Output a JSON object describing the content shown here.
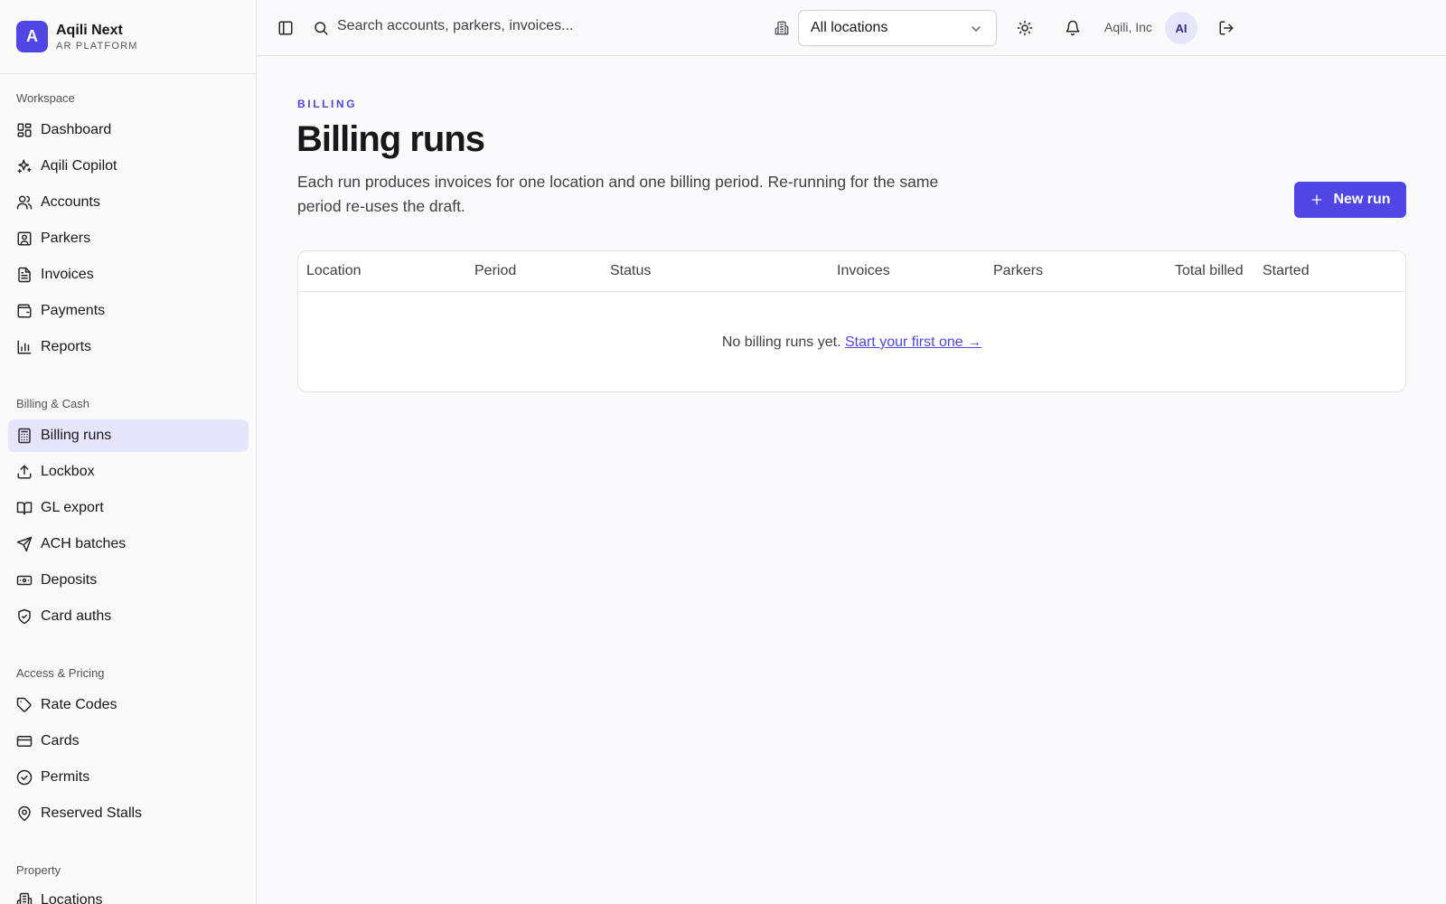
{
  "brand": {
    "logo_letter": "A",
    "name": "Aqili Next",
    "subtitle": "AR PLATFORM"
  },
  "sidebar": {
    "sections": [
      {
        "title": "Workspace",
        "items": [
          {
            "label": "Dashboard",
            "icon": "dashboard-icon"
          },
          {
            "label": "Aqili Copilot",
            "icon": "sparkles-icon"
          },
          {
            "label": "Accounts",
            "icon": "users-icon"
          },
          {
            "label": "Parkers",
            "icon": "contact-icon"
          },
          {
            "label": "Invoices",
            "icon": "file-text-icon"
          },
          {
            "label": "Payments",
            "icon": "wallet-icon"
          },
          {
            "label": "Reports",
            "icon": "bar-chart-icon"
          }
        ]
      },
      {
        "title": "Billing & Cash",
        "items": [
          {
            "label": "Billing runs",
            "icon": "calculator-icon",
            "active": true
          },
          {
            "label": "Lockbox",
            "icon": "upload-icon"
          },
          {
            "label": "GL export",
            "icon": "book-icon"
          },
          {
            "label": "ACH batches",
            "icon": "send-icon"
          },
          {
            "label": "Deposits",
            "icon": "banknote-icon"
          },
          {
            "label": "Card auths",
            "icon": "shield-icon"
          }
        ]
      },
      {
        "title": "Access & Pricing",
        "items": [
          {
            "label": "Rate Codes",
            "icon": "tag-icon"
          },
          {
            "label": "Cards",
            "icon": "credit-card-icon"
          },
          {
            "label": "Permits",
            "icon": "badge-check-icon"
          },
          {
            "label": "Reserved Stalls",
            "icon": "map-pin-icon"
          }
        ]
      },
      {
        "title": "Property",
        "items": [
          {
            "label": "Locations",
            "icon": "building-icon"
          }
        ]
      }
    ]
  },
  "topbar": {
    "search_placeholder": "Search accounts, parkers, invoices...",
    "location_select": "All locations",
    "org_name": "Aqili, Inc",
    "avatar_initials": "AI"
  },
  "main": {
    "eyebrow": "BILLING",
    "title": "Billing runs",
    "description": "Each run produces invoices for one location and one billing period. Re-running for the same period re-uses the draft.",
    "new_run_label": "New run",
    "table": {
      "columns": [
        "Location",
        "Period",
        "Status",
        "Invoices",
        "Parkers",
        "Total billed",
        "Started"
      ],
      "empty_text": "No billing runs yet.",
      "empty_link": "Start your first one →"
    }
  },
  "colors": {
    "accent": "#4f46e5",
    "active_nav_bg": "#e5e6fb"
  }
}
